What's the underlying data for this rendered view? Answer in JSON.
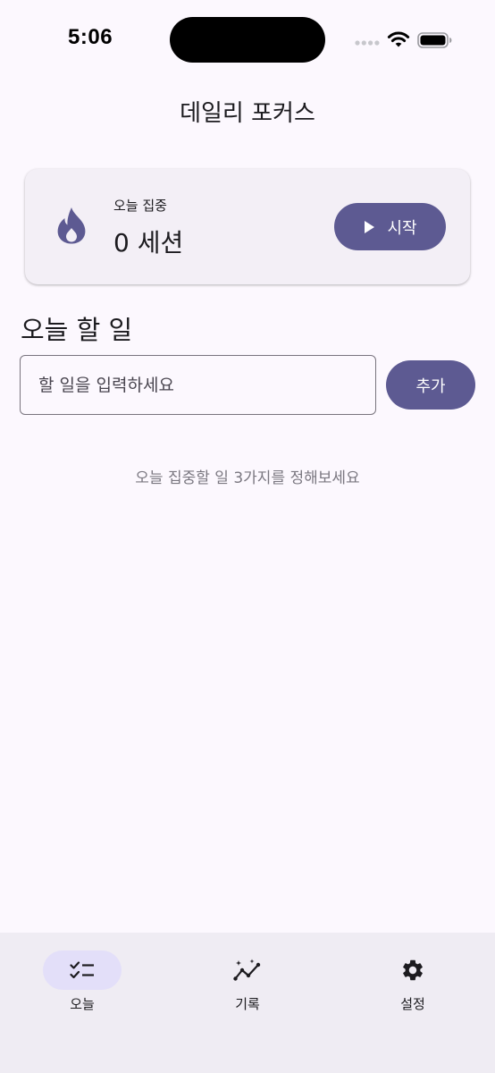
{
  "status_bar": {
    "time": "5:06"
  },
  "header": {
    "title": "데일리 포커스"
  },
  "focus_card": {
    "icon": "flame-icon",
    "label": "오늘 집중",
    "value": "0 세션",
    "start_label": "시작"
  },
  "tasks": {
    "title": "오늘 할 일",
    "input_placeholder": "할 일을 입력하세요",
    "input_value": "",
    "add_label": "추가",
    "empty_hint": "오늘 집중할 일 3가지를 정해보세요"
  },
  "bottom_nav": {
    "items": [
      {
        "label": "오늘",
        "icon": "checklist-icon",
        "active": true
      },
      {
        "label": "기록",
        "icon": "insights-icon",
        "active": false
      },
      {
        "label": "설정",
        "icon": "gear-icon",
        "active": false
      }
    ]
  },
  "colors": {
    "primary": "#5d5a92",
    "background": "#fcf8fe",
    "card": "#f3eff6",
    "nav_indicator": "#e3dff9"
  }
}
